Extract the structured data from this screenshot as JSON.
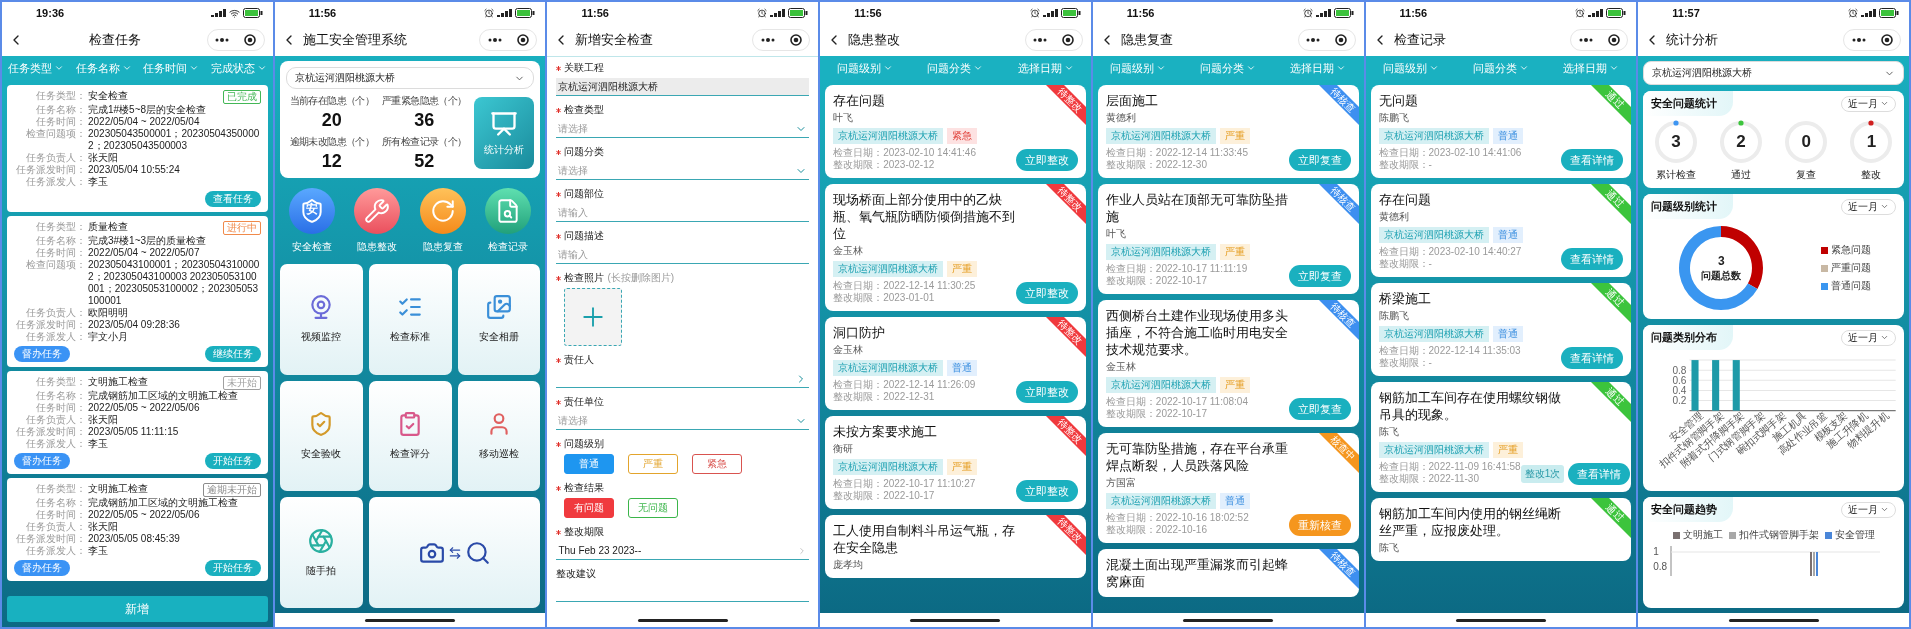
{
  "panels": [
    {
      "kind": "task_list",
      "time": "19:36",
      "title": "检查任务",
      "filters": [
        "任务类型",
        "任务名称",
        "任务时间",
        "完成状态"
      ],
      "tasks": [
        {
          "status": {
            "text": "已完成",
            "color": "#43b756"
          },
          "fields": [
            {
              "label": "任务类型：",
              "value": "安全检查"
            },
            {
              "label": "任务名称：",
              "value": "完成1#楼5~8层的安全检查"
            },
            {
              "label": "任务时间：",
              "value": "2022/05/04 ~ 2022/05/04"
            },
            {
              "label": "检查问题项：",
              "value": "202305043500001；202305043500002；202305043500003"
            },
            {
              "label": "任务负责人：",
              "value": "张天阳"
            },
            {
              "label": "任务派发时间：",
              "value": "2023/05/04  10:55:24"
            },
            {
              "label": "任务派发人：",
              "value": "李玉"
            }
          ],
          "action_button": "查看任务"
        },
        {
          "status": {
            "text": "进行中",
            "color": "#f08a4b"
          },
          "fields": [
            {
              "label": "任务类型：",
              "value": "质量检查"
            },
            {
              "label": "任务名称：",
              "value": "完成3#楼1~3层的质量检查"
            },
            {
              "label": "任务时间：",
              "value": "2022/05/04 ~ 2022/05/07"
            },
            {
              "label": "检查问题项：",
              "value": "202305043100001；202305043100002；202305043100003 202305053100001；202305053100002；202305053100001"
            },
            {
              "label": "任务负责人：",
              "value": "欧阳明明"
            },
            {
              "label": "任务派发时间：",
              "value": "2023/05/04  09:28:36"
            },
            {
              "label": "任务派发人：",
              "value": "宇文小月"
            }
          ],
          "supervise_button": "督办任务",
          "action_button": "继续任务"
        },
        {
          "status": {
            "text": "未开始",
            "color": "#a0a0a0"
          },
          "fields": [
            {
              "label": "任务类型：",
              "value": "文明施工检查"
            },
            {
              "label": "任务名称：",
              "value": "完成钢筋加工区域的文明施工检查"
            },
            {
              "label": "任务时间：",
              "value": "2022/05/05 ~ 2022/05/06"
            },
            {
              "label": "任务负责人：",
              "value": "张天阳"
            },
            {
              "label": "任务派发时间：",
              "value": "2023/05/05  11:11:15"
            },
            {
              "label": "任务派发人：",
              "value": "李玉"
            }
          ],
          "supervise_button": "督办任务",
          "action_button": "开始任务"
        },
        {
          "status": {
            "text": "逾期未开始",
            "color": "#8c8c8c"
          },
          "fields": [
            {
              "label": "任务类型：",
              "value": "文明施工检查"
            },
            {
              "label": "任务名称：",
              "value": "完成钢筋加工区域的文明施工检查"
            },
            {
              "label": "任务时间：",
              "value": "2022/05/05 ~ 2022/05/06"
            },
            {
              "label": "任务负责人：",
              "value": "张天阳"
            },
            {
              "label": "任务派发时间：",
              "value": "2023/05/05  08:45:39"
            },
            {
              "label": "任务派发人：",
              "value": "李玉"
            }
          ],
          "supervise_button": "督办任务",
          "action_button": "开始任务"
        }
      ],
      "add_button": "新增"
    },
    {
      "kind": "home",
      "time": "11:56",
      "title": "施工安全管理系统",
      "project": "京杭运河泗阳桃源大桥",
      "stats": [
        {
          "label": "当前存在隐患（个）",
          "value": "20"
        },
        {
          "label": "严重紧急隐患（个）",
          "value": "36"
        },
        {
          "label": "逾期未改隐患（个）",
          "value": "12"
        },
        {
          "label": "所有检查记录（个）",
          "value": "52"
        }
      ],
      "analysis_button": "统计分析",
      "quick_entries": [
        {
          "label": "安全检查",
          "kind": "shield",
          "glyph": "安"
        },
        {
          "label": "隐患整改",
          "kind": "tools"
        },
        {
          "label": "隐患复查",
          "kind": "review"
        },
        {
          "label": "检查记录",
          "kind": "record"
        }
      ],
      "tiles": [
        {
          "label": "视频监控",
          "kind": "camera"
        },
        {
          "label": "检查标准",
          "kind": "checklist"
        },
        {
          "label": "安全相册",
          "kind": "album"
        },
        {
          "label": "安全验收",
          "kind": "acceptance"
        },
        {
          "label": "检查评分",
          "kind": "score"
        },
        {
          "label": "移动巡检",
          "kind": "patrol"
        },
        {
          "label": "随手拍",
          "kind": "snapshot"
        },
        {
          "kind": "photo_compare"
        }
      ]
    },
    {
      "kind": "form",
      "time": "11:56",
      "title": "新增安全检查",
      "fields": [
        {
          "kind": "text",
          "label": "关联工程",
          "required": true,
          "value": "京杭运河泗阳桃源大桥"
        },
        {
          "kind": "select",
          "label": "检查类型",
          "required": true,
          "placeholder": "请选择"
        },
        {
          "kind": "select",
          "label": "问题分类",
          "required": true,
          "placeholder": "请选择"
        },
        {
          "kind": "input",
          "label": "问题部位",
          "required": true,
          "placeholder": "请输入"
        },
        {
          "kind": "input",
          "label": "问题描述",
          "required": true,
          "placeholder": "请输入"
        },
        {
          "kind": "photo",
          "label": "检查照片",
          "required": true,
          "hint": "(长按删除图片)"
        },
        {
          "kind": "picker",
          "label": "责任人",
          "required": true
        },
        {
          "kind": "select",
          "label": "责任单位",
          "required": true,
          "placeholder": "请选择"
        },
        {
          "kind": "options",
          "label": "问题级别",
          "required": true,
          "options": [
            {
              "text": "普通",
              "color": "#1e96f0",
              "selected": true
            },
            {
              "text": "严重",
              "color": "#e3a42c",
              "selected": false
            },
            {
              "text": "紧急",
              "color": "#d9534f",
              "selected": false
            }
          ]
        },
        {
          "kind": "options",
          "label": "检查结果",
          "required": true,
          "options": [
            {
              "text": "有问题",
              "color": "#f03a3e",
              "selected": true
            },
            {
              "text": "无问题",
              "color": "#3bb54a",
              "selected": false
            }
          ]
        },
        {
          "kind": "date",
          "label": "整改期限",
          "required": true,
          "value": "Thu Feb 23 2023--"
        },
        {
          "kind": "input",
          "label": "整改建议",
          "required": false
        }
      ]
    },
    {
      "kind": "issue_list",
      "time": "11:56",
      "title": "隐患整改",
      "filters": [
        "问题级别",
        "问题分类",
        "选择日期"
      ],
      "cards": [
        {
          "title": "存在问题",
          "person": "叶飞",
          "tags": [
            {
              "text": "京杭运河泗阳桃源大桥",
              "kind": "project"
            },
            {
              "text": "紧急",
              "kind": "urgent"
            }
          ],
          "check_date": "检查日期：2023-02-10 14:41:46",
          "deadline": "整改期限：2023-02-12",
          "button": {
            "text": "立即整改",
            "kind": "primary"
          },
          "ribbon": {
            "text": "待整改",
            "color": "#f0393d"
          }
        },
        {
          "title": "现场桥面上部分使用中的乙炔瓶、氧气瓶防晒防倾倒措施不到位",
          "person": "金玉林",
          "tags": [
            {
              "text": "京杭运河泗阳桃源大桥",
              "kind": "project"
            },
            {
              "text": "严重",
              "kind": "serious"
            }
          ],
          "check_date": "检查日期：2022-12-14 11:30:25",
          "deadline": "整改期限：2023-01-01",
          "button": {
            "text": "立即整改",
            "kind": "primary"
          },
          "ribbon": {
            "text": "待整改",
            "color": "#f0393d"
          }
        },
        {
          "title": "洞口防护",
          "person": "金玉林",
          "tags": [
            {
              "text": "京杭运河泗阳桃源大桥",
              "kind": "project"
            },
            {
              "text": "普通",
              "kind": "normal"
            }
          ],
          "check_date": "检查日期：2022-12-14 11:26:09",
          "deadline": "整改期限：2022-12-31",
          "button": {
            "text": "立即整改",
            "kind": "primary"
          },
          "ribbon": {
            "text": "待整改",
            "color": "#f0393d"
          }
        },
        {
          "title": "未按方案要求施工",
          "person": "衡研",
          "tags": [
            {
              "text": "京杭运河泗阳桃源大桥",
              "kind": "project"
            },
            {
              "text": "严重",
              "kind": "serious"
            }
          ],
          "check_date": "检查日期：2022-10-17 11:10:27",
          "deadline": "整改期限：2022-10-17",
          "button": {
            "text": "立即整改",
            "kind": "primary"
          },
          "ribbon": {
            "text": "待整改",
            "color": "#f0393d"
          }
        },
        {
          "title": "工人使用自制料斗吊运气瓶，存在安全隐患",
          "person": "庞孝均",
          "ribbon": {
            "text": "待整改",
            "color": "#f0393d"
          }
        }
      ]
    },
    {
      "kind": "issue_list",
      "time": "11:56",
      "title": "隐患复查",
      "filters": [
        "问题级别",
        "问题分类",
        "选择日期"
      ],
      "cards": [
        {
          "title": "层面施工",
          "person": "黄德利",
          "tags": [
            {
              "text": "京杭运河泗阳桃源大桥",
              "kind": "project"
            },
            {
              "text": "严重",
              "kind": "serious"
            }
          ],
          "check_date": "检查日期：2022-12-14 11:33:45",
          "deadline": "整改期限：2022-12-30",
          "button": {
            "text": "立即复查",
            "kind": "primary"
          },
          "ribbon": {
            "text": "待核查",
            "color": "#3d8ff0"
          }
        },
        {
          "title": "作业人员站在顶部无可靠防坠措施",
          "person": "叶飞",
          "tags": [
            {
              "text": "京杭运河泗阳桃源大桥",
              "kind": "project"
            },
            {
              "text": "严重",
              "kind": "serious"
            }
          ],
          "check_date": "检查日期：2022-10-17 11:11:19",
          "deadline": "整改期限：2022-10-17",
          "button": {
            "text": "立即复查",
            "kind": "primary"
          },
          "ribbon": {
            "text": "待核查",
            "color": "#3d8ff0"
          }
        },
        {
          "title": "西侧桥台土建作业现场使用多头插座，不符合施工临时用电安全技术规范要求。",
          "person": "金玉林",
          "tags": [
            {
              "text": "京杭运河泗阳桃源大桥",
              "kind": "project"
            },
            {
              "text": "严重",
              "kind": "serious"
            }
          ],
          "check_date": "检查日期：2022-10-17 11:08:04",
          "deadline": "整改期限：2022-10-17",
          "button": {
            "text": "立即复查",
            "kind": "primary"
          },
          "ribbon": {
            "text": "待核查",
            "color": "#3d8ff0"
          }
        },
        {
          "title": "无可靠防坠措施，存在平台承重焊点断裂，人员跌落风险",
          "person": "方国富",
          "tags": [
            {
              "text": "京杭运河泗阳桃源大桥",
              "kind": "project"
            },
            {
              "text": "普通",
              "kind": "normal"
            }
          ],
          "check_date": "检查日期：2022-10-16 18:02:52",
          "deadline": "整改期限：2022-10-16",
          "button": {
            "text": "重新核查",
            "kind": "retry"
          },
          "ribbon": {
            "text": "核查中",
            "color": "#f5961e"
          }
        },
        {
          "title": "混凝土面出现严重漏浆而引起蜂窝麻面",
          "ribbon": {
            "text": "待核查",
            "color": "#3d8ff0"
          }
        }
      ]
    },
    {
      "kind": "issue_list",
      "time": "11:56",
      "title": "检查记录",
      "filters": [
        "问题级别",
        "问题分类",
        "选择日期"
      ],
      "cards": [
        {
          "title": "无问题",
          "person": "陈鹏飞",
          "tags": [
            {
              "text": "京杭运河泗阳桃源大桥",
              "kind": "project"
            },
            {
              "text": "普通",
              "kind": "normal"
            }
          ],
          "check_date": "检查日期：2023-02-10 14:41:06",
          "deadline": "整改期限：-",
          "button": {
            "text": "查看详情",
            "kind": "primary"
          },
          "ribbon": {
            "text": "通过",
            "color": "#3cc43c"
          }
        },
        {
          "title": "存在问题",
          "person": "黄德利",
          "tags": [
            {
              "text": "京杭运河泗阳桃源大桥",
              "kind": "project"
            },
            {
              "text": "普通",
              "kind": "normal"
            }
          ],
          "check_date": "检查日期：2023-02-10 14:40:27",
          "deadline": "整改期限：-",
          "button": {
            "text": "查看详情",
            "kind": "primary"
          },
          "ribbon": {
            "text": "通过",
            "color": "#3cc43c"
          }
        },
        {
          "title": "桥梁施工",
          "person": "陈鹏飞",
          "tags": [
            {
              "text": "京杭运河泗阳桃源大桥",
              "kind": "project"
            },
            {
              "text": "普通",
              "kind": "normal"
            }
          ],
          "check_date": "检查日期：2022-12-14 11:35:03",
          "deadline": "整改期限：-",
          "button": {
            "text": "查看详情",
            "kind": "primary"
          },
          "ribbon": {
            "text": "通过",
            "color": "#3cc43c"
          }
        },
        {
          "title": "钢筋加工车间存在使用螺纹钢做吊具的现象。",
          "person": "陈飞",
          "tags": [
            {
              "text": "京杭运河泗阳桃源大桥",
              "kind": "project"
            },
            {
              "text": "严重",
              "kind": "serious"
            }
          ],
          "check_date": "检查日期：2022-11-09 16:41:58",
          "deadline": "整改期限：2022-11-30",
          "count_badge": "整改1次",
          "button": {
            "text": "查看详情",
            "kind": "primary"
          },
          "ribbon": {
            "text": "通过",
            "color": "#3cc43c"
          }
        },
        {
          "title": "钢筋加工车间内使用的钢丝绳断丝严重，应报废处理。",
          "person": "陈飞",
          "ribbon": {
            "text": "通过",
            "color": "#3cc43c"
          }
        }
      ]
    },
    {
      "kind": "statistics",
      "time": "11:57",
      "title": "统计分析",
      "project": "京杭运河泗阳桃源大桥",
      "summary": {
        "title": "安全问题统计",
        "period": "近一月",
        "rings": [
          {
            "value": "3",
            "label": "累计检查",
            "color": "#3d95f2"
          },
          {
            "value": "2",
            "label": "通过",
            "color": "#3cc43c"
          },
          {
            "value": "0",
            "label": "复查"
          },
          {
            "value": "1",
            "label": "整改",
            "color": "#d02020"
          }
        ]
      },
      "level_stats": {
        "title": "问题级别统计",
        "period": "近一月",
        "total": "3",
        "total_label": "问题总数",
        "legend": [
          {
            "color": "#c00000"
          },
          {
            "color": "#c8b8a4"
          },
          {
            "color": "#3a96f0"
          }
        ],
        "chart_data": {
          "type": "donut",
          "categories": [
            "紧急问题",
            "严重问题",
            "普通问题"
          ],
          "values": [
            33.3,
            0,
            66.7
          ]
        }
      },
      "category_stats": {
        "title": "问题类别分布",
        "period": "近一月",
        "chart_data": {
          "type": "bar",
          "categories": [
            "安全管理",
            "扣件式钢管脚手架",
            "附着式升降脚手架",
            "门式钢管脚手架",
            "碗扣式脚手架",
            "施工机具",
            "高处作业吊篮",
            "模板支架",
            "施工升降机",
            "物料提升机"
          ],
          "series": [
            {
              "color": "#1e9aa8",
              "values": [
                1,
                1,
                1,
                0,
                0,
                0,
                0,
                0,
                0,
                0
              ]
            }
          ],
          "ylim": [
            0,
            1
          ],
          "yticks": [
            0.2,
            0.4,
            0.6,
            0.8
          ],
          "grid": true
        }
      },
      "trend": {
        "title": "安全问题趋势",
        "period": "近一月",
        "legend": [
          {
            "name": "文明施工",
            "color": "#7a7070"
          },
          {
            "name": "扣件式钢管脚手架",
            "color": "#a8a8a8"
          },
          {
            "name": "安全管理",
            "color": "#4a86d8"
          }
        ],
        "y_labels": [
          "1",
          "0.8"
        ]
      }
    }
  ]
}
